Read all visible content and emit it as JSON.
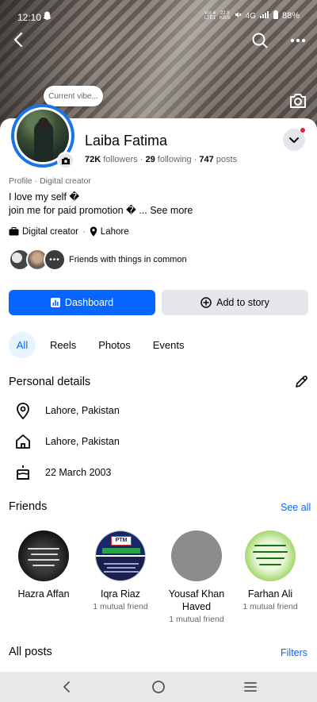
{
  "status_bar": {
    "time": "12:10",
    "network_small_top": "Vo) 4",
    "network_small_bottom": "LTE1",
    "speed_top": "22.5",
    "speed_bottom": "KB/S",
    "network": "4G",
    "battery": "88%"
  },
  "note": {
    "text": "Current vibe..."
  },
  "profile": {
    "name": "Laiba Fatima",
    "followers": "72K",
    "followers_label": "followers",
    "following": "29",
    "following_label": "following",
    "posts": "747",
    "posts_label": "posts",
    "category_line": "Profile · Digital creator",
    "bio_line1": "I love my self �",
    "bio_line2": "join me for paid promotion � ...",
    "see_more": "See more",
    "chip_category": "Digital creator",
    "chip_location": "Lahore",
    "mutual_text": "Friends with things in common"
  },
  "actions": {
    "dashboard_label": "Dashboard",
    "add_story_label": "Add to story"
  },
  "tabs": [
    {
      "label": "All",
      "active": true
    },
    {
      "label": "Reels",
      "active": false
    },
    {
      "label": "Photos",
      "active": false
    },
    {
      "label": "Events",
      "active": false
    }
  ],
  "personal_details": {
    "title": "Personal details",
    "items": [
      {
        "icon": "location-pin-icon",
        "text": "Lahore, Pakistan"
      },
      {
        "icon": "home-icon",
        "text": "Lahore, Pakistan"
      },
      {
        "icon": "birthday-cake-icon",
        "text": "22 March 2003"
      }
    ]
  },
  "friends": {
    "title": "Friends",
    "see_all": "See all",
    "list": [
      {
        "name": "Hazra Affan",
        "mutual": ""
      },
      {
        "name": "Iqra Riaz",
        "mutual": "1 mutual friend",
        "logo": "PTM"
      },
      {
        "name": "Yousaf Khan Haved",
        "mutual": "1 mutual friend"
      },
      {
        "name": "Farhan Ali",
        "mutual": "1 mutual friend"
      }
    ]
  },
  "posts": {
    "title": "All posts",
    "filters": "Filters"
  },
  "colors": {
    "accent": "#0866ff",
    "notification_dot": "#e41e3f",
    "secondary_button": "#e4e6eb"
  }
}
